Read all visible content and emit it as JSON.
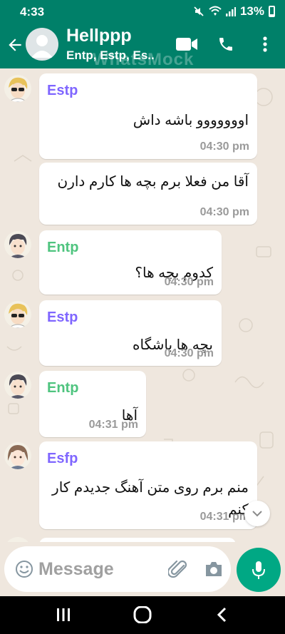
{
  "status": {
    "time": "4:33",
    "battery": "13%"
  },
  "header": {
    "title": "Hellppp",
    "subtitle": "Entp, Estp, Es..",
    "watermark": "WhatsMock"
  },
  "messages": [
    {
      "sender": "Estp",
      "sender_color": "#7f66ff",
      "text": "اووووووو باشه داش",
      "time": "04:30 pm",
      "avatar": "sunglasses-blond"
    },
    {
      "sender": "",
      "sender_color": "",
      "text": "آقا من فعلا برم بچه ها کارم دارن",
      "time": "04:30 pm",
      "avatar": ""
    },
    {
      "sender": "Entp",
      "sender_color": "#4fc47f",
      "text": "کدوم بچه ها؟",
      "time": "04:30 pm",
      "avatar": "dark-hair-boy"
    },
    {
      "sender": "Estp",
      "sender_color": "#7f66ff",
      "text": "بچه ها باشگاه",
      "time": "04:30 pm",
      "avatar": "sunglasses-blond"
    },
    {
      "sender": "Entp",
      "sender_color": "#4fc47f",
      "text": "آها",
      "time": "04:31 pm",
      "avatar": "dark-hair-boy"
    },
    {
      "sender": "Esfp",
      "sender_color": "#7f66ff",
      "text": "منم برم روی متن آهنگ جدیدم کار کنم",
      "time": "04:31 pm",
      "avatar": "brown-hair-girl"
    }
  ],
  "composer": {
    "placeholder": "Message"
  },
  "colors": {
    "header": "#008069",
    "accent": "#00a884",
    "chat_bg": "#efe7de"
  }
}
